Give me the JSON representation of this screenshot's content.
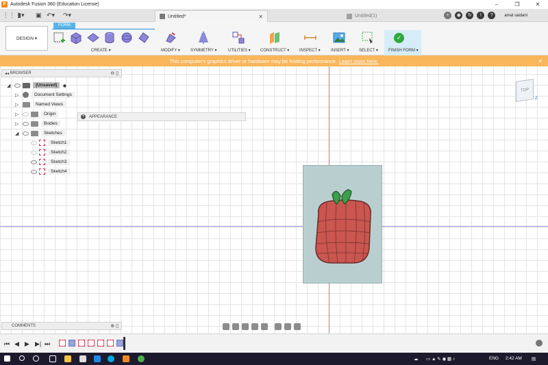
{
  "window": {
    "title": "Autodesk Fusion 360 (Education License)",
    "minimize": "–",
    "maximize": "❐",
    "close": "✕"
  },
  "tabs": {
    "active": "Untitled*",
    "inactive": "Untitled(1)",
    "close_glyph": "✕"
  },
  "user": {
    "name": "amal saidani"
  },
  "toolbar": {
    "workspace": "DESIGN",
    "active_tab": "FORM",
    "groups": [
      "CREATE",
      "MODIFY",
      "SYMMETRY",
      "UTILITIES",
      "CONSTRUCT",
      "INSPECT",
      "INSERT",
      "SELECT",
      "FINISH FORM"
    ]
  },
  "warning": {
    "message": "This computer's graphics driver or hardware may be limiting performance.",
    "link": "Learn more here."
  },
  "browser": {
    "title": "BROWSER",
    "root": "(Unsaved)",
    "items": [
      {
        "label": "Document Settings"
      },
      {
        "label": "Named Views"
      },
      {
        "label": "Origin"
      },
      {
        "label": "Bodies"
      },
      {
        "label": "Sketches"
      },
      {
        "label": "Sketch1"
      },
      {
        "label": "Sketch2"
      },
      {
        "label": "Sketch3"
      },
      {
        "label": "Sketch4"
      }
    ],
    "appearance": "APPEARANCE"
  },
  "viewcube": {
    "face": "TOP",
    "axis_z": "Z"
  },
  "comments": {
    "title": "COMMENTS"
  },
  "taskbar": {
    "language": "ENG",
    "time": "2:42 AM"
  },
  "colors": {
    "accent": "#2b8ed6",
    "warning": "#f9b65b",
    "finish": "#2fa83d",
    "model_body": "#c9564f",
    "leaves": "#3aa04a"
  }
}
